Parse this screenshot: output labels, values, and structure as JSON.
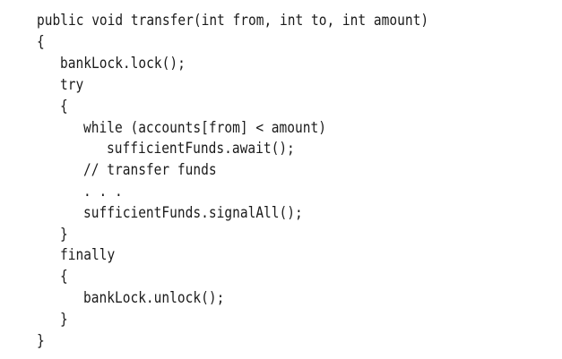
{
  "code": {
    "lines": [
      "public void transfer(int from, int to, int amount)",
      "{",
      "bankLock.lock();",
      "try",
      "{",
      "while (accounts[from] < amount)",
      "sufficientFunds.await();",
      "// transfer funds",
      ". . .",
      "sufficientFunds.signalAll();",
      "}",
      "finally",
      "{",
      "bankLock.unlock();",
      "}",
      "}"
    ]
  }
}
